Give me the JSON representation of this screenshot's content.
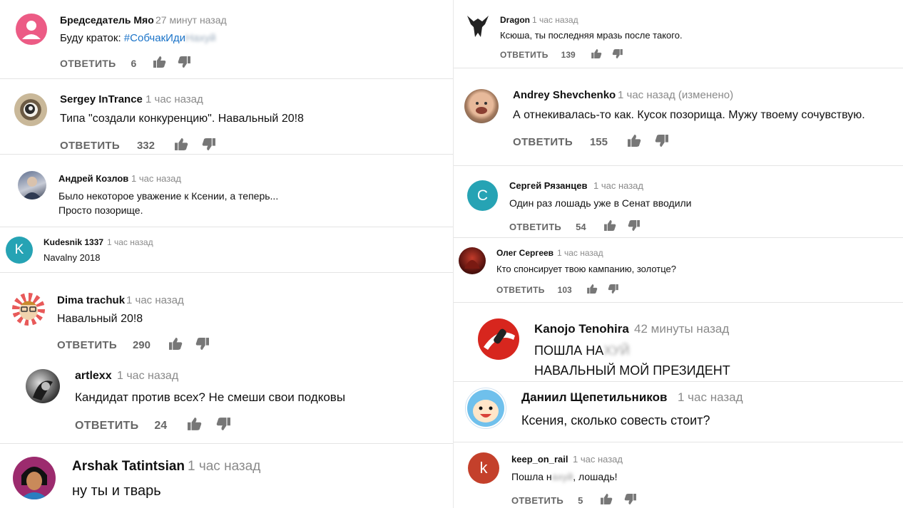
{
  "colors": {
    "link": "#1a73c8",
    "name": "#111111",
    "time": "#8a8a8a",
    "action": "#666666"
  },
  "left": [
    {
      "name": "Бредседатель Мяо",
      "time": "27 минут назад",
      "text": "Буду краток: ",
      "hashtag": "#СобчакИди",
      "hashtag_blur": "Нахуй",
      "reply": "ОТВЕТИТЬ",
      "likes": "6"
    },
    {
      "name": "Sergey InTrance",
      "time": "1 час назад",
      "text": "Типа \"создали конкуренцию\". Навальный 20!8",
      "reply": "ОТВЕТИТЬ",
      "likes": "332"
    },
    {
      "name": "Андрей Козлов",
      "time": "1 час назад",
      "text1": "Было некоторое уважение к Ксении, а теперь...",
      "text2": "Просто позорище."
    },
    {
      "initial": "K",
      "name": "Kudesnik 1337",
      "time": "1 час назад",
      "text": "Navalny 2018"
    },
    {
      "name": "Dima trachuk",
      "time": "1 час назад",
      "text": "Навальный 20!8",
      "reply": "ОТВЕТИТЬ",
      "likes": "290"
    },
    {
      "name": "artlexx",
      "time": "1 час назад",
      "text": "Кандидат против всех? Не смеши свои подковы",
      "reply": "ОТВЕТИТЬ",
      "likes": "24"
    },
    {
      "name": "Arshak Tatintsian",
      "time": "1 час назад",
      "text": "ну ты и тварь"
    }
  ],
  "right": [
    {
      "name": "Dragon",
      "time": "1 час назад",
      "text": "Ксюша, ты последняя мразь после такого.",
      "reply": "ОТВЕТИТЬ",
      "likes": "139"
    },
    {
      "name": "Andrey Shevchenko",
      "time": "1 час назад (изменено)",
      "text": "А отнекивалась-то как. Кусок позорища. Мужу твоему сочувствую.",
      "reply": "ОТВЕТИТЬ",
      "likes": "155"
    },
    {
      "initial": "С",
      "name": "Сергей Рязанцев",
      "time": "1 час назад",
      "text": "Один раз лошадь уже в Сенат вводили",
      "reply": "ОТВЕТИТЬ",
      "likes": "54"
    },
    {
      "name": "Олег Сергеев",
      "time": "1 час назад",
      "text": "Кто спонсирует твою кампанию, золотце?",
      "reply": "ОТВЕТИТЬ",
      "likes": "103"
    },
    {
      "name": "Kanojo Tenohira",
      "time": "42 минуты назад",
      "text1": "ПОШЛА НА",
      "text1_blur": "ХУЙ",
      "text2": "НАВАЛЬНЫЙ МОЙ ПРЕЗИДЕНТ"
    },
    {
      "name": "Даниил Щепетильников",
      "time": "1 час назад",
      "text": "Ксения, сколько совесть стоит?"
    },
    {
      "initial": "k",
      "name": "keep_on_rail",
      "time": "1 час назад",
      "text_a": "Пошла н",
      "text_blur": "ахуй",
      "text_b": ", лошадь!",
      "reply": "ОТВЕТИТЬ",
      "likes": "5"
    }
  ]
}
